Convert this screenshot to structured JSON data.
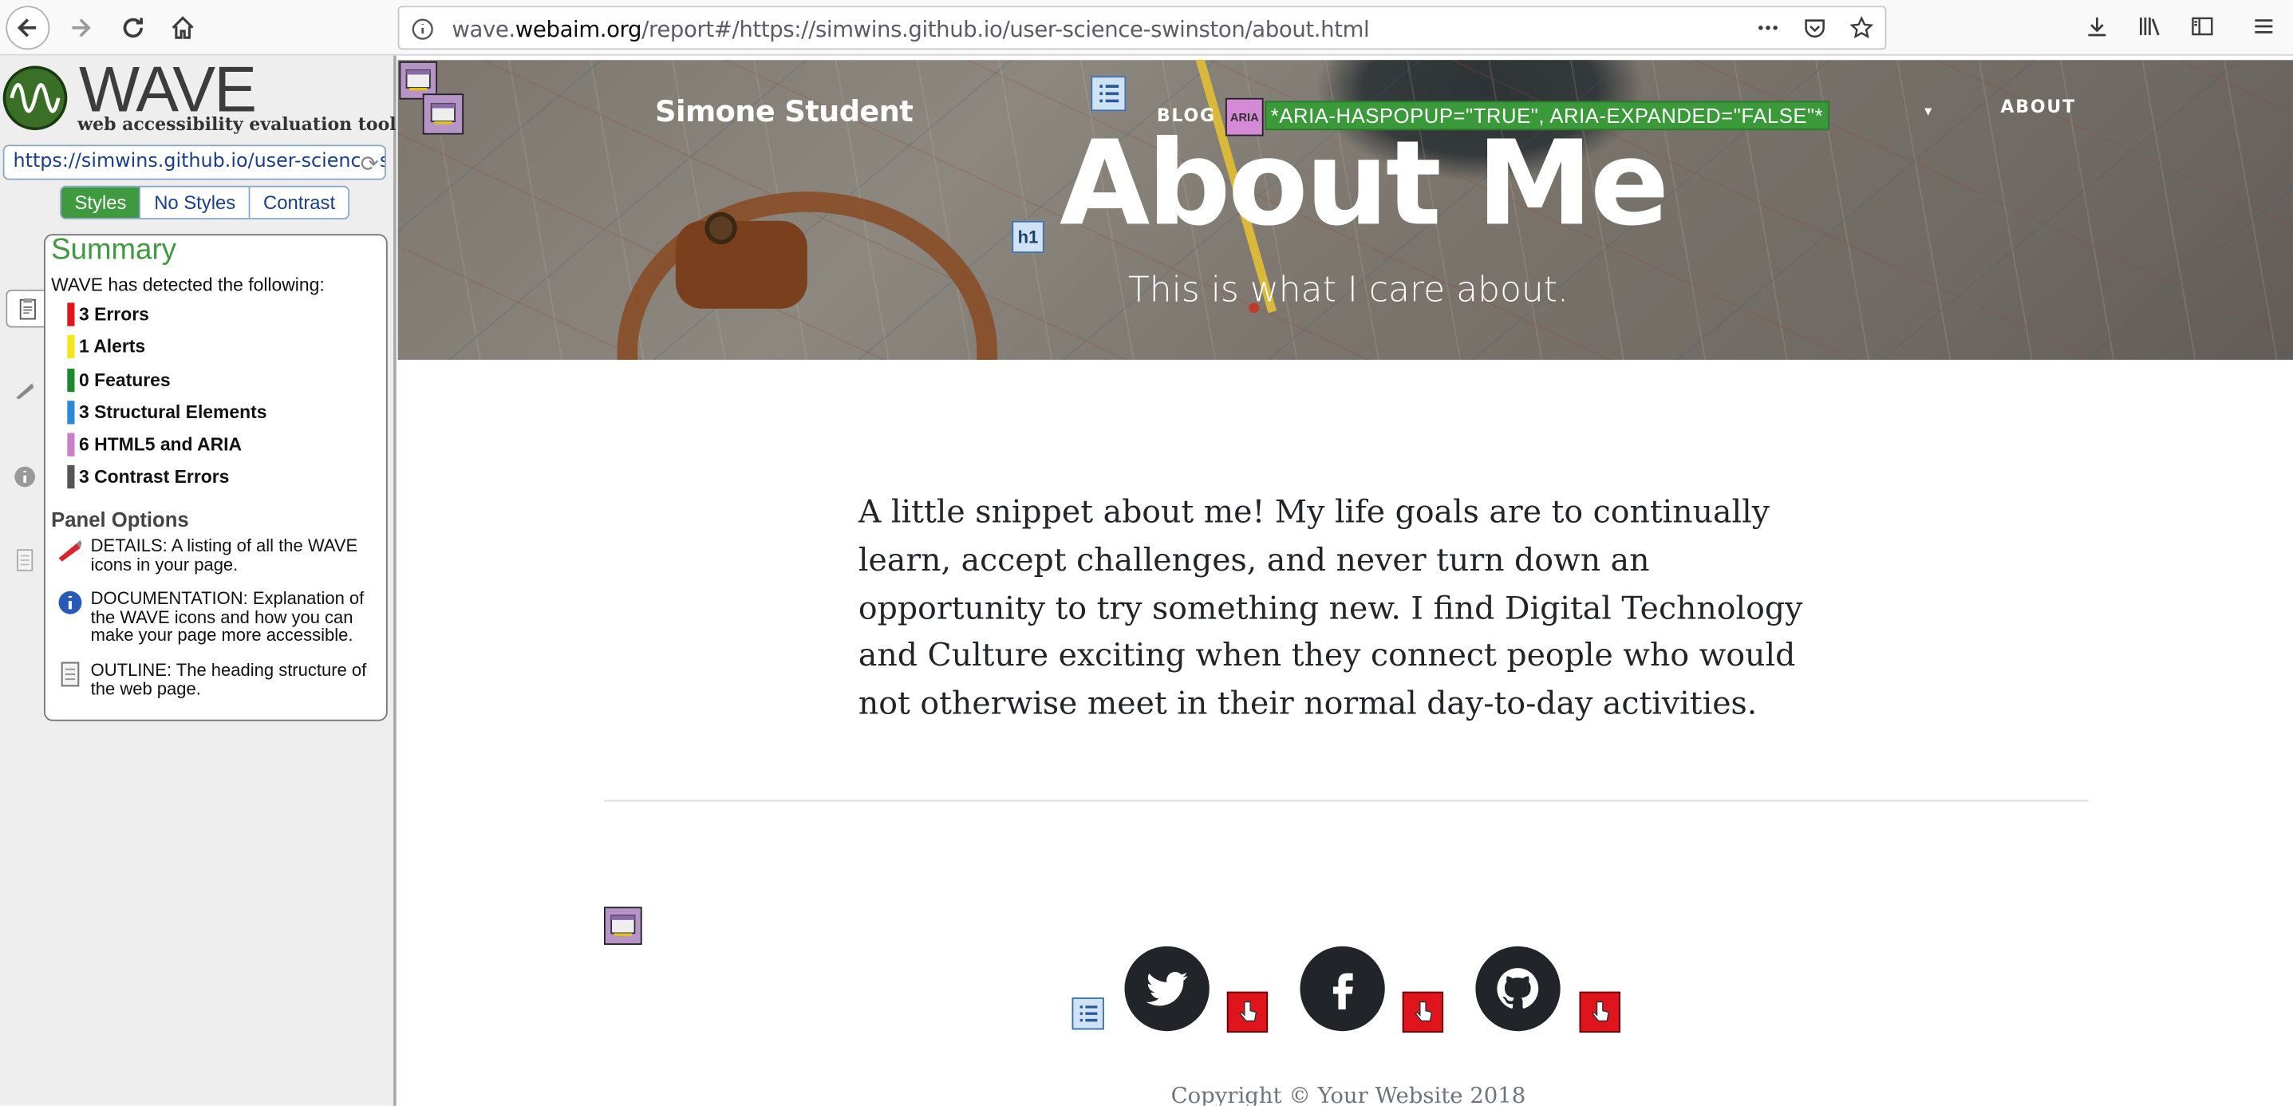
{
  "browser": {
    "url_prefix": "wave.",
    "url_domain": "webaim.org",
    "url_rest": "/report#/https://simwins.github.io/user-science-swinston/about.html"
  },
  "wave": {
    "title": "WAVE",
    "subtitle": "web accessibility evaluation tool",
    "report_url": "https://simwins.github.io/user-science-swinston/about.html",
    "view_tabs": [
      "Styles",
      "No Styles",
      "Contrast"
    ],
    "summary_heading": "Summary",
    "detected_text": "WAVE has detected the following:",
    "summary": [
      {
        "label": "3 Errors",
        "color": "#e0141c"
      },
      {
        "label": "1 Alerts",
        "color": "#f5e61a"
      },
      {
        "label": "0 Features",
        "color": "#1a8a2a"
      },
      {
        "label": "3 Structural Elements",
        "color": "#2a8ad8"
      },
      {
        "label": "6 HTML5 and ARIA",
        "color": "#c880c8"
      },
      {
        "label": "3 Contrast Errors",
        "color": "#555555"
      }
    ],
    "panel_options_heading": "Panel Options",
    "options": [
      {
        "label": "DETAILS: A listing of all the WAVE icons in your page.",
        "icon": "details-icon"
      },
      {
        "label": "DOCUMENTATION: Explanation of the WAVE icons and how you can make your page more accessible.",
        "icon": "info-icon"
      },
      {
        "label": "OUTLINE: The heading structure of the web page.",
        "icon": "outline-icon"
      }
    ]
  },
  "site": {
    "brand": "Simone Student",
    "nav_blog": "BLOG",
    "nav_about": "ABOUT",
    "aria_label": "*ARIA-HASPOPUP=\"TRUE\", ARIA-EXPANDED=\"FALSE\"*",
    "aria_badge": "ARIA",
    "h1_badge": "h1",
    "hero_title": "About Me",
    "hero_subtitle": "This is what I care about.",
    "body": "A little snippet about me! My life goals are to continually learn, accept challenges, and never turn down an opportunity to try something new. I find Digital Technology and Culture exciting when they connect people who would not otherwise meet in their normal day-to-day activities.",
    "social": [
      "twitter-icon",
      "facebook-icon",
      "github-icon"
    ],
    "copyright": "Copyright © Your Website 2018"
  }
}
